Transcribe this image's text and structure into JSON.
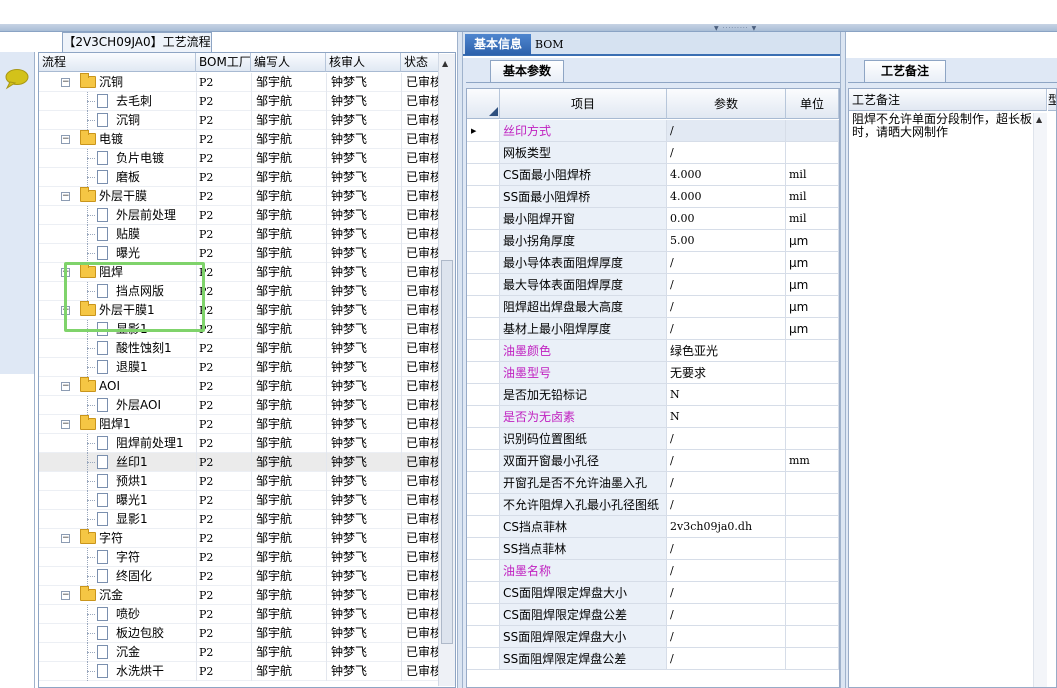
{
  "tree_panel": {
    "tab_title": "【2V3CH09JA0】工艺流程",
    "columns": [
      "流程",
      "BOM工厂",
      "编写人",
      "核审人",
      "状态"
    ],
    "rows": [
      {
        "name": "沉铜",
        "type": "folder",
        "level": 0,
        "bom": "P2",
        "writer": "邹宇航",
        "reviewer": "钟梦飞",
        "status": "已审核"
      },
      {
        "name": "去毛刺",
        "type": "doc",
        "level": 1,
        "bom": "P2",
        "writer": "邹宇航",
        "reviewer": "钟梦飞",
        "status": "已审核"
      },
      {
        "name": "沉铜",
        "type": "doc",
        "level": 1,
        "bom": "P2",
        "writer": "邹宇航",
        "reviewer": "钟梦飞",
        "status": "已审核"
      },
      {
        "name": "电镀",
        "type": "folder",
        "level": 0,
        "bom": "P2",
        "writer": "邹宇航",
        "reviewer": "钟梦飞",
        "status": "已审核"
      },
      {
        "name": "负片电镀",
        "type": "doc",
        "level": 1,
        "bom": "P2",
        "writer": "邹宇航",
        "reviewer": "钟梦飞",
        "status": "已审核"
      },
      {
        "name": "磨板",
        "type": "doc",
        "level": 1,
        "bom": "P2",
        "writer": "邹宇航",
        "reviewer": "钟梦飞",
        "status": "已审核"
      },
      {
        "name": "外层干膜",
        "type": "folder",
        "level": 0,
        "bom": "P2",
        "writer": "邹宇航",
        "reviewer": "钟梦飞",
        "status": "已审核"
      },
      {
        "name": "外层前处理",
        "type": "doc",
        "level": 1,
        "bom": "P2",
        "writer": "邹宇航",
        "reviewer": "钟梦飞",
        "status": "已审核"
      },
      {
        "name": "贴膜",
        "type": "doc",
        "level": 1,
        "bom": "P2",
        "writer": "邹宇航",
        "reviewer": "钟梦飞",
        "status": "已审核"
      },
      {
        "name": "曝光",
        "type": "doc",
        "level": 1,
        "bom": "P2",
        "writer": "邹宇航",
        "reviewer": "钟梦飞",
        "status": "已审核"
      },
      {
        "name": "阻焊",
        "type": "folder",
        "level": 0,
        "bom": "P2",
        "writer": "邹宇航",
        "reviewer": "钟梦飞",
        "status": "已审核"
      },
      {
        "name": "挡点网版",
        "type": "doc",
        "level": 1,
        "bom": "P2",
        "writer": "邹宇航",
        "reviewer": "钟梦飞",
        "status": "已审核"
      },
      {
        "name": "外层干膜1",
        "type": "folder",
        "level": 0,
        "bom": "P2",
        "writer": "邹宇航",
        "reviewer": "钟梦飞",
        "status": "已审核"
      },
      {
        "name": "显影1",
        "type": "doc",
        "level": 1,
        "bom": "P2",
        "writer": "邹宇航",
        "reviewer": "钟梦飞",
        "status": "已审核"
      },
      {
        "name": "酸性蚀刻1",
        "type": "doc",
        "level": 1,
        "bom": "P2",
        "writer": "邹宇航",
        "reviewer": "钟梦飞",
        "status": "已审核"
      },
      {
        "name": "退膜1",
        "type": "doc",
        "level": 1,
        "bom": "P2",
        "writer": "邹宇航",
        "reviewer": "钟梦飞",
        "status": "已审核"
      },
      {
        "name": "AOI",
        "type": "folder",
        "level": 0,
        "bom": "P2",
        "writer": "邹宇航",
        "reviewer": "钟梦飞",
        "status": "已审核"
      },
      {
        "name": "外层AOI",
        "type": "doc",
        "level": 1,
        "bom": "P2",
        "writer": "邹宇航",
        "reviewer": "钟梦飞",
        "status": "已审核"
      },
      {
        "name": "阻焊1",
        "type": "folder",
        "level": 0,
        "bom": "P2",
        "writer": "邹宇航",
        "reviewer": "钟梦飞",
        "status": "已审核"
      },
      {
        "name": "阻焊前处理1",
        "type": "doc",
        "level": 1,
        "bom": "P2",
        "writer": "邹宇航",
        "reviewer": "钟梦飞",
        "status": "已审核"
      },
      {
        "name": "丝印1",
        "type": "doc",
        "level": 1,
        "bom": "P2",
        "writer": "邹宇航",
        "reviewer": "钟梦飞",
        "status": "已审核",
        "selected": true
      },
      {
        "name": "预烘1",
        "type": "doc",
        "level": 1,
        "bom": "P2",
        "writer": "邹宇航",
        "reviewer": "钟梦飞",
        "status": "已审核"
      },
      {
        "name": "曝光1",
        "type": "doc",
        "level": 1,
        "bom": "P2",
        "writer": "邹宇航",
        "reviewer": "钟梦飞",
        "status": "已审核"
      },
      {
        "name": "显影1",
        "type": "doc",
        "level": 1,
        "bom": "P2",
        "writer": "邹宇航",
        "reviewer": "钟梦飞",
        "status": "已审核"
      },
      {
        "name": "字符",
        "type": "folder",
        "level": 0,
        "bom": "P2",
        "writer": "邹宇航",
        "reviewer": "钟梦飞",
        "status": "已审核"
      },
      {
        "name": "字符",
        "type": "doc",
        "level": 1,
        "bom": "P2",
        "writer": "邹宇航",
        "reviewer": "钟梦飞",
        "status": "已审核"
      },
      {
        "name": "终固化",
        "type": "doc",
        "level": 1,
        "bom": "P2",
        "writer": "邹宇航",
        "reviewer": "钟梦飞",
        "status": "已审核"
      },
      {
        "name": "沉金",
        "type": "folder",
        "level": 0,
        "bom": "P2",
        "writer": "邹宇航",
        "reviewer": "钟梦飞",
        "status": "已审核"
      },
      {
        "name": "喷砂",
        "type": "doc",
        "level": 1,
        "bom": "P2",
        "writer": "邹宇航",
        "reviewer": "钟梦飞",
        "status": "已审核"
      },
      {
        "name": "板边包胶",
        "type": "doc",
        "level": 1,
        "bom": "P2",
        "writer": "邹宇航",
        "reviewer": "钟梦飞",
        "status": "已审核"
      },
      {
        "name": "沉金",
        "type": "doc",
        "level": 1,
        "bom": "P2",
        "writer": "邹宇航",
        "reviewer": "钟梦飞",
        "status": "已审核"
      },
      {
        "name": "水洗烘干",
        "type": "doc",
        "level": 1,
        "bom": "P2",
        "writer": "邹宇航",
        "reviewer": "钟梦飞",
        "status": "已审核"
      }
    ]
  },
  "middle_panel": {
    "tabs": [
      "基本信息",
      "BOM"
    ],
    "active_tab": "基本信息",
    "subtab": "基本参数",
    "columns": [
      "项目",
      "参数",
      "单位"
    ],
    "rows": [
      {
        "item": "丝印方式",
        "value": "/",
        "unit": "",
        "highlight": true,
        "current": true
      },
      {
        "item": "网板类型",
        "value": "/",
        "unit": ""
      },
      {
        "item": "CS面最小阻焊桥",
        "value": "4.000",
        "unit": "mil"
      },
      {
        "item": "SS面最小阻焊桥",
        "value": "4.000",
        "unit": "mil"
      },
      {
        "item": "最小阻焊开窗",
        "value": "0.00",
        "unit": "mil"
      },
      {
        "item": "最小拐角厚度",
        "value": "5.00",
        "unit": "μm"
      },
      {
        "item": "最小导体表面阻焊厚度",
        "value": "/",
        "unit": "μm"
      },
      {
        "item": "最大导体表面阻焊厚度",
        "value": "/",
        "unit": "μm"
      },
      {
        "item": "阻焊超出焊盘最大高度",
        "value": "/",
        "unit": "μm"
      },
      {
        "item": "基材上最小阻焊厚度",
        "value": "/",
        "unit": "μm"
      },
      {
        "item": "油墨颜色",
        "value": "绿色亚光",
        "unit": "",
        "highlight": true
      },
      {
        "item": "油墨型号",
        "value": "无要求",
        "unit": "",
        "highlight": true
      },
      {
        "item": "是否加无铅标记",
        "value": "N",
        "unit": ""
      },
      {
        "item": "是否为无卤素",
        "value": "N",
        "unit": "",
        "highlight": true
      },
      {
        "item": "识别码位置图纸",
        "value": "/",
        "unit": ""
      },
      {
        "item": "双面开窗最小孔径",
        "value": "/",
        "unit": "mm"
      },
      {
        "item": "开窗孔是否不允许油墨入孔",
        "value": "/",
        "unit": ""
      },
      {
        "item": "不允许阻焊入孔最小孔径图纸",
        "value": "/",
        "unit": ""
      },
      {
        "item": "CS挡点菲林",
        "value": "2v3ch09ja0.dh",
        "unit": ""
      },
      {
        "item": "SS挡点菲林",
        "value": "/",
        "unit": ""
      },
      {
        "item": "油墨名称",
        "value": "/",
        "unit": "",
        "highlight": true
      },
      {
        "item": "CS面阻焊限定焊盘大小",
        "value": "/",
        "unit": ""
      },
      {
        "item": "CS面阻焊限定焊盘公差",
        "value": "/",
        "unit": ""
      },
      {
        "item": "SS面阻焊限定焊盘大小",
        "value": "/",
        "unit": ""
      },
      {
        "item": "SS面阻焊限定焊盘公差",
        "value": "/",
        "unit": ""
      }
    ]
  },
  "right_panel": {
    "tab": "工艺备注",
    "column": "工艺备注",
    "column2": "型",
    "note": "阻焊不允许单面分段制作，超长板时，请晒大网制作"
  },
  "colors": {
    "accent": "#2d61ab",
    "highlight_text": "#c020c0",
    "callout": "#7fd36b"
  },
  "icons": [
    "chat-bubble-icon",
    "folder-icon",
    "document-icon",
    "expand-icon",
    "scroll-up-icon",
    "row-pointer-icon"
  ]
}
